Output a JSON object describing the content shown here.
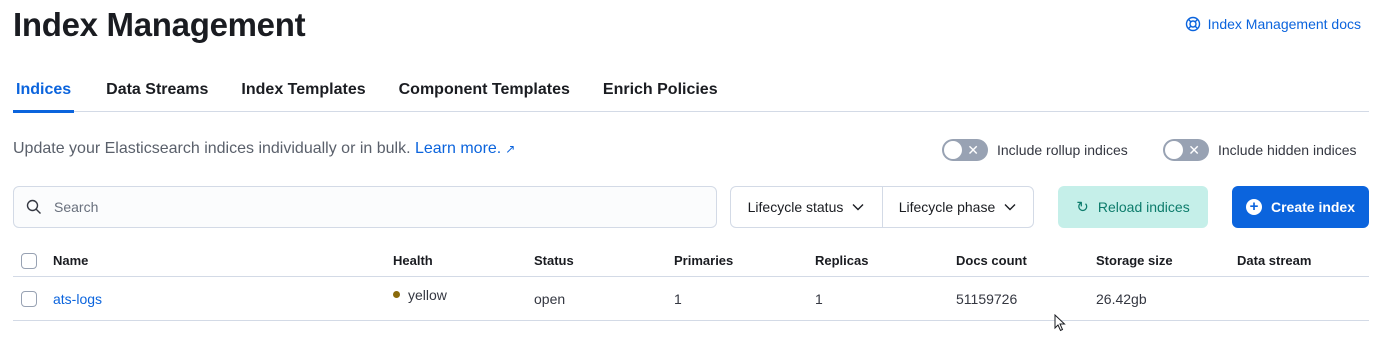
{
  "header": {
    "title": "Index Management",
    "docs_link": "Index Management docs"
  },
  "tabs": [
    {
      "label": "Indices",
      "active": true
    },
    {
      "label": "Data Streams",
      "active": false
    },
    {
      "label": "Index Templates",
      "active": false
    },
    {
      "label": "Component Templates",
      "active": false
    },
    {
      "label": "Enrich Policies",
      "active": false
    }
  ],
  "description": {
    "text": "Update your Elasticsearch indices individually or in bulk.",
    "learn_more": "Learn more."
  },
  "toggles": {
    "rollup": {
      "label": "Include rollup indices",
      "on": false
    },
    "hidden": {
      "label": "Include hidden indices",
      "on": false
    }
  },
  "toolbar": {
    "search_placeholder": "Search",
    "filter_lifecycle_status": "Lifecycle status",
    "filter_lifecycle_phase": "Lifecycle phase",
    "reload_label": "Reload indices",
    "create_label": "Create index"
  },
  "table": {
    "columns": [
      "Name",
      "Health",
      "Status",
      "Primaries",
      "Replicas",
      "Docs count",
      "Storage size",
      "Data stream"
    ],
    "rows": [
      {
        "name": "ats-logs",
        "health": "yellow",
        "status": "open",
        "primaries": "1",
        "replicas": "1",
        "docs_count": "51159726",
        "storage_size": "26.42gb",
        "data_stream": ""
      }
    ]
  },
  "colors": {
    "accent": "#0b64dd",
    "health_yellow": "#8a6a0a",
    "reload_bg": "#c5efe9"
  }
}
